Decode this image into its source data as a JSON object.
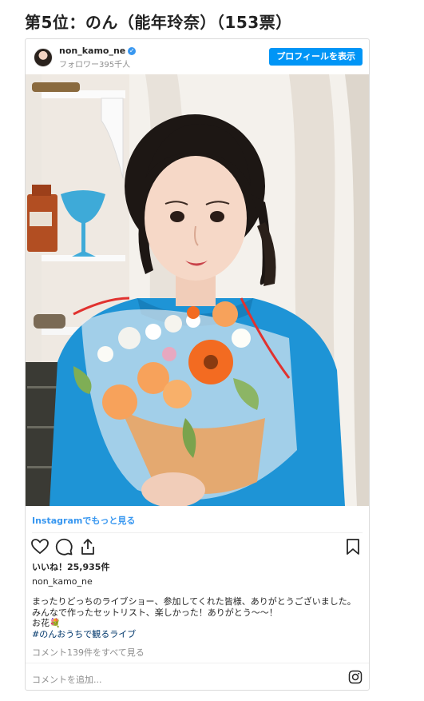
{
  "heading": "第5位：のん（能年玲奈）（153票）",
  "post": {
    "username": "non_kamo_ne",
    "followers": "フォロワー395千人",
    "profile_button": "プロフィールを表示",
    "more_link": "Instagramでもっと見る",
    "likes": "いいね！25,935件",
    "caption_author": "non_kamo_ne",
    "caption_lines": [
      "まったりどっちのライブショー、参加してくれた皆様、ありがとうございました。",
      "みんなで作ったセットリスト、楽しかった！ありがとう〜〜！",
      "お花💐",
      "#のんおうちで観るライブ"
    ],
    "view_comments": "コメント139件をすべて見る",
    "add_comment_placeholder": "コメントを追加..."
  },
  "icons": {
    "verified": "verified-badge-icon",
    "like": "heart-icon",
    "comment": "comment-bubble-icon",
    "share": "share-icon",
    "save": "bookmark-icon",
    "instagram": "instagram-logo-icon"
  },
  "colors": {
    "accent": "#0095f6",
    "link": "#3897f0",
    "hashtag": "#00376b",
    "muted": "#8e8e8e",
    "border": "#dbdbdb"
  }
}
